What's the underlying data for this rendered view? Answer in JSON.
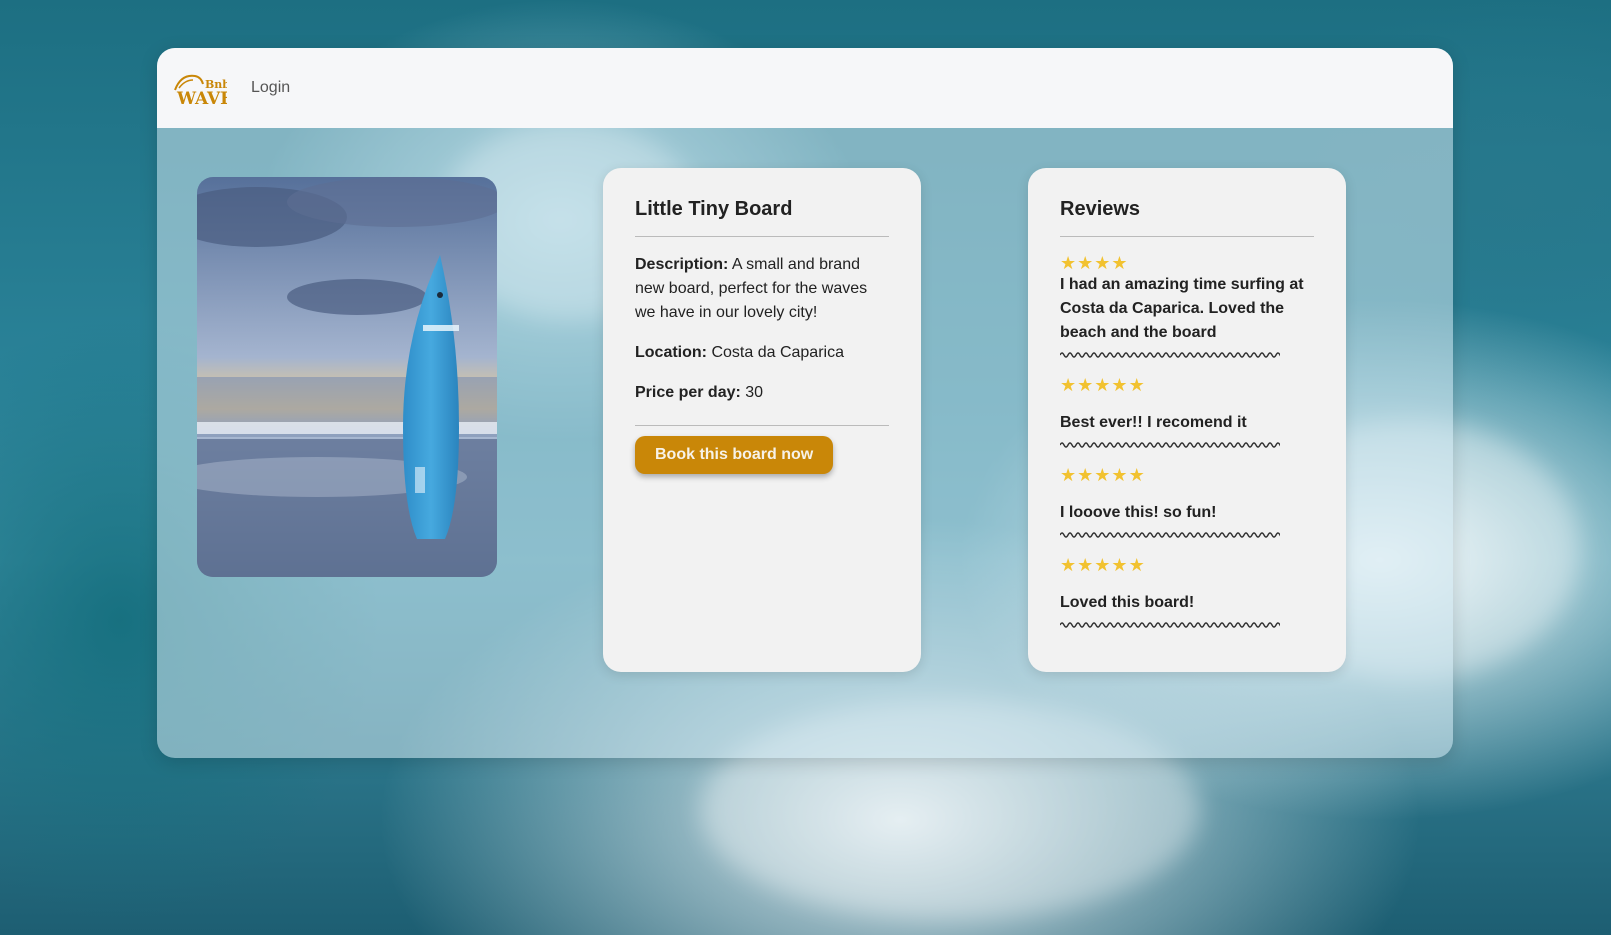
{
  "nav": {
    "logo_text_top": "Bnb",
    "logo_text_bottom": "WAVE",
    "login_label": "Login"
  },
  "board": {
    "image_alt": "surfboard-photo",
    "title": "Little Tiny Board",
    "description_label": "Description:",
    "description": "A small and brand new board, perfect for the waves we have in our lovely city!",
    "location_label": "Location:",
    "location": "Costa da Caparica",
    "price_label": "Price per day:",
    "price": "30",
    "book_label": "Book this board now"
  },
  "reviews": {
    "title": "Reviews",
    "items": [
      {
        "stars": 4,
        "text": "I had an amazing time surfing at Costa da Caparica. Loved the beach and the board"
      },
      {
        "stars": 5,
        "text": "Best ever!! I recomend it"
      },
      {
        "stars": 5,
        "text": "I looove this! so fun!"
      },
      {
        "stars": 5,
        "text": "Loved this board!"
      }
    ]
  },
  "colors": {
    "accent": "#c98708",
    "star": "#f2c230",
    "panel": "#f2f2f2"
  }
}
